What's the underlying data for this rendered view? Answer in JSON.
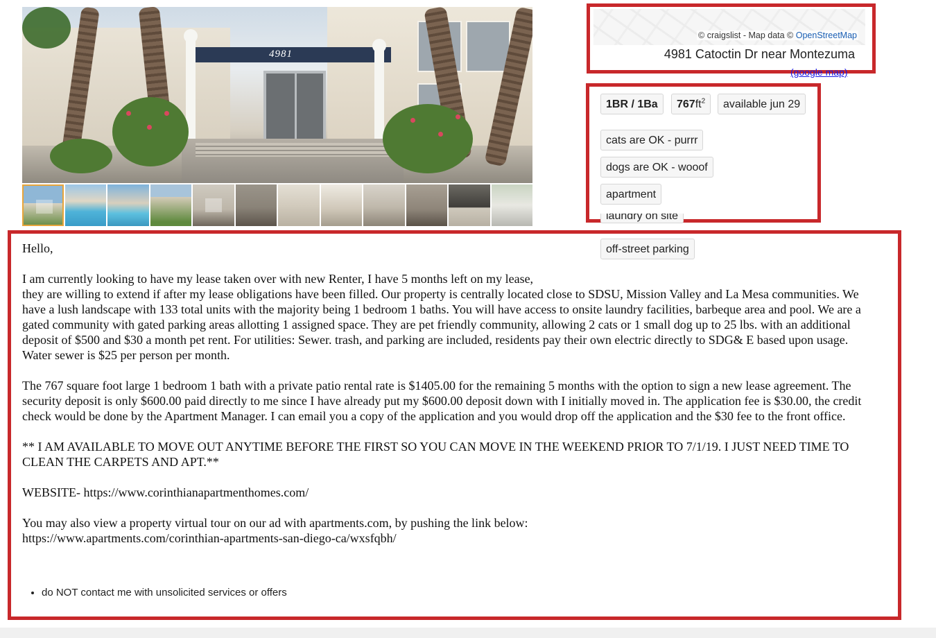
{
  "map": {
    "attribution_prefix": "© craigslist - Map data ©",
    "attribution_link": "OpenStreetMap",
    "address": "4981 Catoctin Dr near Montezuma",
    "google_map_link": "(google map)"
  },
  "photo": {
    "building_number": "4981",
    "thumbnail_count": 12
  },
  "attributes": {
    "bedrooms_baths": "1BR / 1Ba",
    "sqft_value": "767",
    "sqft_unit": "ft",
    "sqft_exp": "2",
    "available": "available jun 29",
    "tags": [
      "cats are OK - purrr",
      "dogs are OK - wooof",
      "apartment",
      "laundry on site",
      "off-street parking"
    ]
  },
  "description": {
    "greeting": "Hello,",
    "p1_line1": "I am currently looking to have my lease taken over with new Renter, I have 5 months left on my lease,",
    "p1_rest": "they are willing to extend if after my lease obligations have been filled. Our property is centrally located close to SDSU, Mission Valley and La Mesa communities. We have a lush landscape with 133 total units with the majority being 1 bedroom 1 baths. You will have access to onsite laundry facilities, barbeque area and pool. We are a gated community with gated parking areas allotting 1 assigned space. They are pet friendly community, allowing 2 cats or 1 small dog up to 25 lbs. with an additional deposit of $500 and $30 a month pet rent. For utilities: Sewer. trash, and parking are included, residents pay their own electric directly to SDG& E based upon usage. Water sewer is $25 per person per month.",
    "p2": "The 767 square foot large 1 bedroom 1 bath with a private patio rental rate is $1405.00 for the remaining 5 months with the option to sign a new lease agreement. The security deposit is only $600.00 paid directly to me since I have already put my $600.00 deposit down with I initially moved in. The application fee is $30.00, the credit check would be done by the Apartment Manager. I can email you a copy of the application and you would drop off the application and the $30 fee to the front office.",
    "p3": "** I AM AVAILABLE TO MOVE OUT ANYTIME BEFORE THE FIRST SO YOU CAN MOVE IN THE WEEKEND PRIOR TO 7/1/19. I JUST NEED TIME TO CLEAN THE CARPETS AND APT.**",
    "website": "WEBSITE- https://www.corinthianapartmenthomes.com/",
    "tour_line1": "You may also view a property virtual tour on our ad with apartments.com, by pushing the link below:",
    "tour_line2": "https://www.apartments.com/corinthian-apartments-san-diego-ca/wxsfqbh/"
  },
  "notices": [
    "do NOT contact me with unsolicited services or offers"
  ],
  "colors": {
    "highlight_border": "#c8282b",
    "active_thumb_border": "#e8a53a",
    "link": "#1a5fb4"
  }
}
